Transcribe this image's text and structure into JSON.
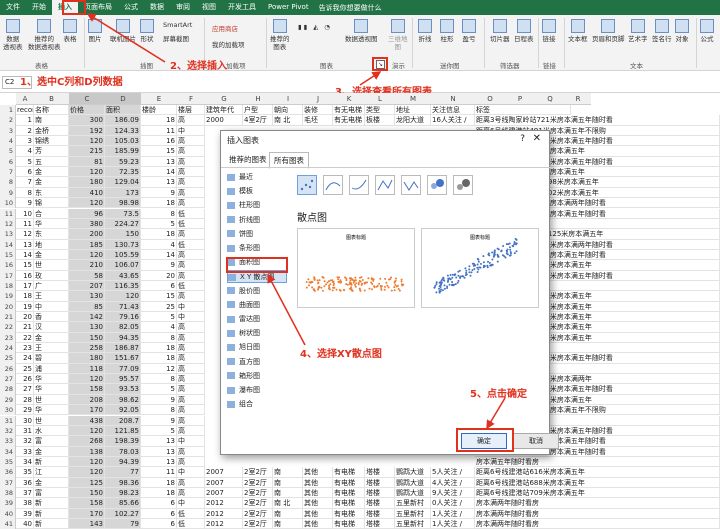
{
  "tabs": [
    "文件",
    "开始",
    "插入",
    "页面布局",
    "公式",
    "数据",
    "审阅",
    "视图",
    "开发工具",
    "Power Pivot"
  ],
  "tell_me": "告诉我你想要做什么",
  "ribbon": {
    "pivot": "数据\n透视表",
    "rec_pivot": "推荐的\n数据透视表",
    "table": "表格",
    "picture": "图片",
    "online_picture": "联机图片",
    "shapes": "形状",
    "smartart": "SmartArt",
    "screenshot": "屏幕截图",
    "store": "应用商店",
    "my_addins": "我的加载项",
    "rec_charts": "推荐的\n图表",
    "pivot_chart": "数据透视图",
    "map3d": "三维地\n图",
    "line": "折线",
    "column": "柱形",
    "winloss": "盈亏",
    "slicer": "切片器",
    "timeline": "日程表",
    "link": "链接",
    "textbox": "文本框",
    "header_footer": "页眉和页脚",
    "wordart": "艺术字",
    "signature": "签名行",
    "object": "对象",
    "equation": "公式",
    "groups": [
      "表格",
      "插图",
      "加载项",
      "图表",
      "演示",
      "迷你图",
      "筛选器",
      "链接",
      "文本"
    ]
  },
  "formula_bar": {
    "name_box": "C2",
    "fx": "fx"
  },
  "annotations": {
    "step1": "1、选中C列和D列数据",
    "step2": "2、选择插入",
    "step3": "3、选择查看所有图表",
    "step4": "4、选择XY散点图",
    "step5": "5、点击确定"
  },
  "columns": [
    "A",
    "B",
    "C",
    "D",
    "E",
    "F",
    "G",
    "H",
    "I",
    "J",
    "K",
    "L",
    "M",
    "N",
    "O",
    "P",
    "Q",
    "R"
  ],
  "header_row": [
    "recordid",
    "名称",
    "价格",
    "面积",
    "楼龄",
    "楼层",
    "建筑年代",
    "户型",
    "朝向",
    "装修",
    "有无电梯",
    "类型",
    "地址",
    "关注信息",
    "标签"
  ],
  "rows": [
    [
      "1",
      "南",
      "300",
      "186.09",
      "18",
      "高"
    ],
    [
      "2",
      "金桥",
      "192",
      "124.33",
      "11",
      "中"
    ],
    [
      "3",
      "锦绣",
      "120",
      "105.03",
      "16",
      "高"
    ],
    [
      "4",
      "芳",
      "215",
      "185.99",
      "15",
      "高"
    ],
    [
      "5",
      "五",
      "81",
      "59.23",
      "13",
      "高"
    ],
    [
      "6",
      "金",
      "120",
      "72.35",
      "14",
      "高"
    ],
    [
      "7",
      "金",
      "180",
      "129.04",
      "13",
      "高"
    ],
    [
      "8",
      "东",
      "410",
      "173",
      "9",
      "高"
    ],
    [
      "9",
      "锦",
      "120",
      "98.98",
      "18",
      "高"
    ],
    [
      "10",
      "合",
      "96",
      "73.5",
      "8",
      "低"
    ],
    [
      "11",
      "华",
      "380",
      "224.27",
      "5",
      "低"
    ],
    [
      "12",
      "东",
      "200",
      "150",
      "18",
      "高"
    ],
    [
      "13",
      "地",
      "185",
      "130.73",
      "4",
      "低"
    ],
    [
      "14",
      "金",
      "120",
      "105.59",
      "14",
      "高"
    ],
    [
      "15",
      "世",
      "210",
      "106.07",
      "9",
      "高"
    ],
    [
      "16",
      "玫",
      "58",
      "43.65",
      "20",
      "高"
    ],
    [
      "17",
      "广",
      "207",
      "116.35",
      "6",
      "低"
    ],
    [
      "18",
      "王",
      "130",
      "120",
      "15",
      "高"
    ],
    [
      "19",
      "中",
      "85",
      "71.43",
      "25",
      "中"
    ],
    [
      "20",
      "香",
      "142",
      "79.16",
      "5",
      "中"
    ],
    [
      "21",
      "汉",
      "130",
      "82.05",
      "4",
      "高"
    ],
    [
      "22",
      "金",
      "150",
      "94.35",
      "8",
      "高"
    ],
    [
      "23",
      "王",
      "258",
      "186.87",
      "18",
      "高"
    ],
    [
      "24",
      "碧",
      "180",
      "151.67",
      "18",
      "高"
    ],
    [
      "25",
      "浦",
      "118",
      "77.09",
      "12",
      "高"
    ],
    [
      "26",
      "华",
      "120",
      "95.57",
      "8",
      "高"
    ],
    [
      "27",
      "华",
      "158",
      "93.53",
      "5",
      "高"
    ],
    [
      "28",
      "世",
      "208",
      "98.62",
      "9",
      "高"
    ],
    [
      "29",
      "华",
      "170",
      "92.05",
      "8",
      "高"
    ],
    [
      "30",
      "世",
      "438",
      "208.7",
      "9",
      "高"
    ],
    [
      "31",
      "水",
      "120",
      "121.85",
      "5",
      "高"
    ],
    [
      "32",
      "富",
      "268",
      "198.39",
      "13",
      "中"
    ],
    [
      "33",
      "金",
      "138",
      "78.03",
      "13",
      "高"
    ],
    [
      "34",
      "新",
      "120",
      "94.39",
      "13",
      "高"
    ],
    [
      "35",
      "江",
      "120",
      "77",
      "11",
      "中"
    ],
    [
      "36",
      "金",
      "125",
      "98.36",
      "18",
      "高"
    ],
    [
      "37",
      "富",
      "150",
      "98.23",
      "18",
      "高"
    ],
    [
      "38",
      "新",
      "158",
      "85.66",
      "6",
      "中"
    ],
    [
      "39",
      "新",
      "170",
      "102.27",
      "6",
      "低"
    ],
    [
      "40",
      "新",
      "143",
      "79",
      "6",
      "低"
    ]
  ],
  "right_rows": [
    [
      "2000",
      "4室2厅",
      "南 北",
      "毛坯",
      "有无电梯",
      "板楼",
      "龙阳大道",
      "16人关注 /",
      "距离3号线陶家岭站721米房本满五年随时看"
    ],
    [
      "",
      "",
      "",
      "",
      "",
      "",
      "",
      "",
      "距离6号线建港站491米房本满五年不限购"
    ],
    [
      "",
      "",
      "",
      "",
      "",
      "",
      "",
      "",
      "距离4号线首义路站702米房本满五年随时看"
    ],
    [
      "",
      "",
      "",
      "",
      "",
      "",
      "",
      "",
      "距离6号线建港站432米房本满五年"
    ],
    [
      "",
      "",
      "",
      "",
      "",
      "",
      "",
      "",
      "距离2号线王家湾站608米房本满五年随时看"
    ],
    [
      "",
      "",
      "",
      "",
      "",
      "",
      "",
      "",
      "距离6号线建港站748米房本满五年"
    ],
    [
      "",
      "",
      "",
      "",
      "",
      "",
      "",
      "",
      "距离3号线汉阳火车站898米房本满五年"
    ],
    [
      "",
      "",
      "",
      "",
      "",
      "",
      "",
      "",
      "距离3号线汉阳火车站702米房本满五年"
    ],
    [
      "",
      "",
      "",
      "",
      "",
      "",
      "",
      "",
      "距离6号线建港站440米房本满两年随时看"
    ],
    [
      "",
      "",
      "",
      "",
      "",
      "",
      "",
      "",
      "距离6号线建港站840米房本满五年随时看"
    ],
    [
      "",
      "",
      "",
      "",
      "",
      "",
      "",
      "",
      "房本满两年随时看房"
    ],
    [
      "",
      "",
      "",
      "",
      "",
      "",
      "",
      "",
      "距离4号线汉阳火车站1125米房本满五年"
    ],
    [
      "",
      "",
      "",
      "",
      "",
      "",
      "",
      "",
      "距离4号线十里铺站596米房本满两年随时看"
    ],
    [
      "",
      "",
      "",
      "",
      "",
      "",
      "",
      "",
      "距离6号线建港站753米房本满五年随时看"
    ],
    [
      "",
      "",
      "",
      "",
      "",
      "",
      "",
      "",
      "距离4号线拦江路站666米房本满五年"
    ],
    [
      "",
      "",
      "",
      "",
      "",
      "",
      "",
      "",
      "距离3号线王家湾站460米房本满五年随时看"
    ],
    [
      "",
      "",
      "",
      "",
      "",
      "",
      "",
      "",
      "房本满两年随时看房"
    ],
    [
      "",
      "",
      "",
      "",
      "",
      "",
      "",
      "",
      "距离3号线王家湾站574米房本满五年"
    ],
    [
      "",
      "",
      "",
      "",
      "",
      "",
      "",
      "",
      "距离4号线五里墩站558米房本满五年"
    ],
    [
      "",
      "",
      "",
      "",
      "",
      "",
      "",
      "",
      "距离4号线十里铺站547米房本满五年"
    ],
    [
      "",
      "",
      "",
      "",
      "",
      "",
      "",
      "",
      "距离4号线拦江路站527米房本满五年"
    ],
    [
      "",
      "",
      "",
      "",
      "",
      "",
      "",
      "",
      "距离4号线五里墩站588米房本满五年"
    ],
    [
      "",
      "",
      "",
      "",
      "",
      "",
      "",
      "",
      "房本满两年随时看房"
    ],
    [
      "",
      "",
      "",
      "",
      "",
      "",
      "",
      "",
      "距离3号线王家湾站699米房本满五年随时看"
    ],
    [
      "",
      "",
      "",
      "",
      "",
      "",
      "",
      "",
      "房本满五年随时看房"
    ],
    [
      "",
      "",
      "",
      "",
      "",
      "",
      "",
      "",
      "距离4号线钟家村站475米房本满两年"
    ],
    [
      "",
      "",
      "",
      "",
      "",
      "",
      "",
      "",
      "距离4号线钟家村站543米房本满五年随时看"
    ],
    [
      "",
      "",
      "",
      "",
      "",
      "",
      "",
      "",
      "距离4号线拦江路站566米房本满五年"
    ],
    [
      "",
      "",
      "",
      "",
      "",
      "",
      "",
      "",
      "距离6号线建港站493米房本满五年不限购"
    ],
    [
      "",
      "",
      "",
      "",
      "",
      "",
      "",
      "",
      "房本满两年"
    ],
    [
      "",
      "",
      "",
      "",
      "",
      "",
      "",
      "",
      "距离3号线陶家岭站379米房本满五年随时看"
    ],
    [
      "",
      "",
      "",
      "",
      "",
      "",
      "",
      "",
      "距离6号线建港站456米房本满五年随时看"
    ],
    [
      "",
      "",
      "",
      "",
      "",
      "",
      "",
      "",
      "距离6号线建港站801米房本满五年随时看"
    ],
    [
      "",
      "",
      "",
      "",
      "",
      "",
      "",
      "",
      "房本满五年随时看房"
    ],
    [
      "2007",
      "2室2厅",
      "南",
      "其他",
      "有电梯",
      "塔楼",
      "鹦鹉大道",
      "5人关注 /",
      "距离6号线建港站616米房本满五年"
    ],
    [
      "2007",
      "2室2厅",
      "南",
      "其他",
      "有电梯",
      "塔楼",
      "鹦鹉大道",
      "4人关注 /",
      "距离6号线建港站688米房本满五年"
    ],
    [
      "2007",
      "2室2厅",
      "南",
      "其他",
      "有电梯",
      "塔楼",
      "鹦鹉大道",
      "9人关注 /",
      "距离6号线建港站709米房本满五年"
    ],
    [
      "2012",
      "2室2厅",
      "南 北",
      "其他",
      "有电梯",
      "塔楼",
      "五里新村",
      "0人关注 /",
      "房本满两年随时看房"
    ],
    [
      "2012",
      "2室2厅",
      "南",
      "其他",
      "有电梯",
      "塔楼",
      "五里新村",
      "1人关注 /",
      "房本满两年随时看房"
    ],
    [
      "2012",
      "2室2厅",
      "南",
      "其他",
      "有电梯",
      "塔楼",
      "五里新村",
      "1人关注 /",
      "房本满两年随时看房"
    ]
  ],
  "dialog": {
    "title": "插入图表",
    "help": "?",
    "close": "✕",
    "tab_recommended": "推荐的图表",
    "tab_all": "所有图表",
    "categories": [
      "最近",
      "模板",
      "柱形图",
      "折线图",
      "饼图",
      "条形图",
      "面积图",
      "X Y 散点图",
      "股价图",
      "曲面图",
      "雷达图",
      "树状图",
      "旭日图",
      "直方图",
      "箱形图",
      "瀑布图",
      "组合"
    ],
    "selected_category": "X Y 散点图",
    "subtype_title": "散点图",
    "preview_title": "图表标题",
    "ok": "确定",
    "cancel": "取消"
  },
  "colors": {
    "excel_green": "#217346",
    "annotation_red": "#e0301e",
    "selection_gray": "#d6d6d6",
    "scatter_orange": "#ed7d31",
    "scatter_blue": "#4472c4"
  }
}
